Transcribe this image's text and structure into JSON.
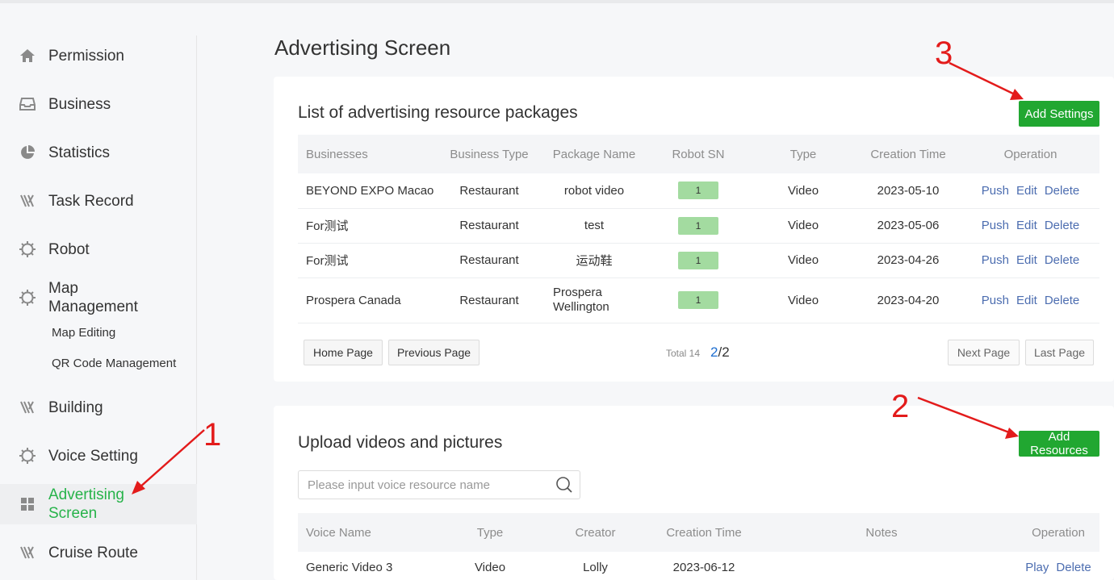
{
  "sidebar": {
    "items": [
      {
        "label": "Permission",
        "icon": "home-icon"
      },
      {
        "label": "Business",
        "icon": "inbox-icon"
      },
      {
        "label": "Statistics",
        "icon": "pie-chart-icon"
      },
      {
        "label": "Task Record",
        "icon": "task-icon"
      },
      {
        "label": "Robot",
        "icon": "gear-icon"
      },
      {
        "label": "Map Management",
        "icon": "gear-icon",
        "children": [
          "Map Editing",
          "QR Code Management"
        ]
      },
      {
        "label": "Building",
        "icon": "building-icon"
      },
      {
        "label": "Voice Setting",
        "icon": "gear-icon"
      },
      {
        "label": "Advertising Screen",
        "icon": "grid-icon",
        "active": true
      },
      {
        "label": "Cruise Route",
        "icon": "route-icon"
      }
    ]
  },
  "page": {
    "title": "Advertising Screen"
  },
  "packages": {
    "title": "List of advertising resource packages",
    "add_button": "Add Settings",
    "columns": [
      "Businesses",
      "Business Type",
      "Package Name",
      "Robot SN",
      "Type",
      "Creation Time",
      "Operation"
    ],
    "rows": [
      {
        "business": "BEYOND EXPO Macao",
        "business_type": "Restaurant",
        "package": "robot video",
        "sn": "1",
        "type": "Video",
        "created": "2023-05-10"
      },
      {
        "business": "For测试",
        "business_type": "Restaurant",
        "package": "test",
        "sn": "1",
        "type": "Video",
        "created": "2023-05-06"
      },
      {
        "business": "For测试",
        "business_type": "Restaurant",
        "package": "运动鞋",
        "sn": "1",
        "type": "Video",
        "created": "2023-04-26"
      },
      {
        "business": "Prospera Canada",
        "business_type": "Restaurant",
        "package": "Prospera Wellington",
        "sn": "1",
        "type": "Video",
        "created": "2023-04-20"
      }
    ],
    "ops": [
      "Push",
      "Edit",
      "Delete"
    ],
    "pagination": {
      "home": "Home Page",
      "previous": "Previous Page",
      "total_label": "Total 14",
      "current": "2",
      "pages": "/2",
      "next": "Next Page",
      "last": "Last Page"
    }
  },
  "resources": {
    "title": "Upload videos and pictures",
    "add_button": "Add Resources",
    "search_placeholder": "Please input voice resource name",
    "columns": [
      "Voice Name",
      "Type",
      "Creator",
      "Creation Time",
      "Notes",
      "Operation"
    ],
    "rows": [
      {
        "name": "Generic Video 3",
        "type": "Video",
        "creator": "Lolly",
        "created": "2023-06-12",
        "notes": ""
      }
    ],
    "ops": [
      "Play",
      "Delete"
    ]
  },
  "annotations": [
    "1",
    "2",
    "3"
  ],
  "colors": {
    "accent_green": "#21a731",
    "active_text": "#27b34a",
    "link": "#4c6db0",
    "annotation_red": "#e31b1b",
    "badge": "#a3dba0"
  }
}
